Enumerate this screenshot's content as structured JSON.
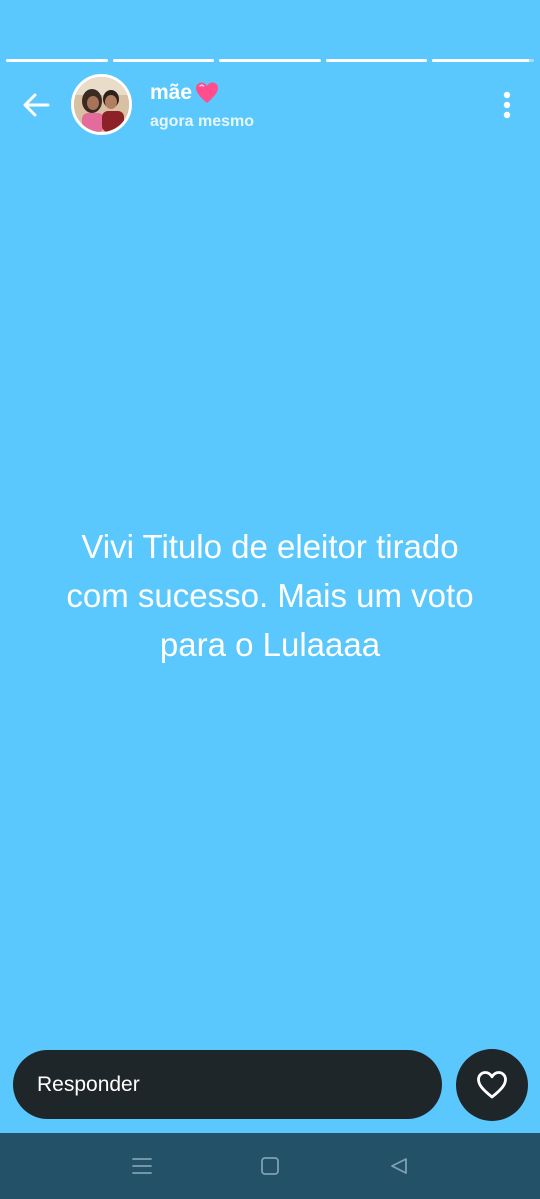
{
  "story": {
    "progress": [
      1,
      1,
      1,
      1,
      0.95
    ],
    "user": {
      "name": "mãe",
      "name_emoji": "pink-heart-icon",
      "timestamp": "agora mesmo"
    },
    "text_lines": [
      "Vivi Titulo de eleitor tirado",
      "com sucesso. Mais um voto",
      "para o Lulaaaa"
    ],
    "background_color": "#5bc8fd"
  },
  "reply": {
    "placeholder": "Responder"
  },
  "icons": {
    "back": "back-arrow-icon",
    "more": "more-vertical-icon",
    "like": "heart-outline-icon",
    "nav_recents": "menu-lines-icon",
    "nav_home": "square-icon",
    "nav_back": "triangle-back-icon"
  },
  "colors": {
    "accent_dark": "#1f2629",
    "nav_bar": "#225168",
    "heart": "#ff4d8d"
  }
}
